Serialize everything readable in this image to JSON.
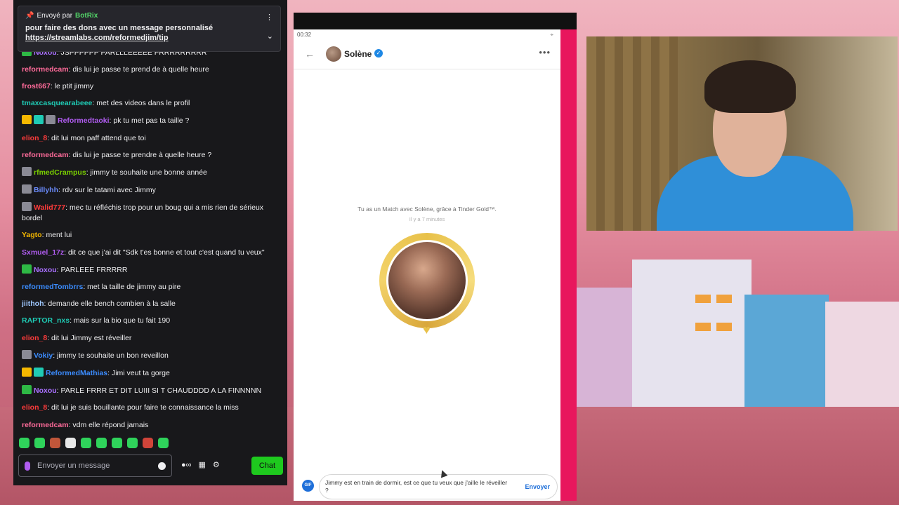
{
  "pinned": {
    "sent_by": "Envoyé par",
    "bot_name": "BotRix",
    "text": "pour faire des dons avec un message personnalisé",
    "link": "https://streamlabs.com/reformedjim/tip"
  },
  "messages": [
    {
      "user": "Noxou",
      "color": "#a970ff",
      "text": "JSPPPPPP PARLLLEEEEE FRRRRRRRRR",
      "badges": [
        "green"
      ]
    },
    {
      "user": "reformedcam",
      "color": "#ff6b9a",
      "text": "dis lui je passe te prend de à quelle heure",
      "badges": []
    },
    {
      "user": "frost667",
      "color": "#ff6b9a",
      "text": "le ptit jimmy",
      "badges": []
    },
    {
      "user": "tmaxcasquearabeee",
      "color": "#1fcbb5",
      "text": "met des videos dans le profil",
      "badges": []
    },
    {
      "user": "Reformedtaoki",
      "color": "#b05cf0",
      "text": "pk tu met pas ta taille ?",
      "badges": [
        "crown",
        "teal",
        "gray"
      ]
    },
    {
      "user": "elion_8",
      "color": "#ff3b3b",
      "text": "dit lui mon paff attend que toi",
      "badges": []
    },
    {
      "user": "reformedcam",
      "color": "#ff6b9a",
      "text": "dis lui je passe te prendre à quelle heure ?",
      "badges": []
    },
    {
      "user": "rfmedCrampus",
      "color": "#7ad000",
      "text": "jimmy te souhaite une bonne année",
      "badges": [
        "gray"
      ]
    },
    {
      "user": "Billyhh",
      "color": "#6b8cff",
      "text": "rdv sur le tatami avec Jimmy",
      "badges": [
        "gray"
      ]
    },
    {
      "user": "Walid777",
      "color": "#ff3b3b",
      "text": "mec tu réfléchis trop pour un boug qui a mis rien de sérieux bordel",
      "badges": [
        "gray"
      ]
    },
    {
      "user": "Yagto",
      "color": "#f5b800",
      "text": "ment lui",
      "badges": []
    },
    {
      "user": "Sxmuel_17z",
      "color": "#b05cf0",
      "text": "dit ce que j'ai dit \"Sdk t'es bonne et tout c'est quand tu veux\"",
      "badges": []
    },
    {
      "user": "Noxou",
      "color": "#a970ff",
      "text": "PARLEEE FRRRRR",
      "badges": [
        "green"
      ]
    },
    {
      "user": "reformedTombrrs",
      "color": "#3b8cff",
      "text": "met la taille de jimmy au pire",
      "badges": []
    },
    {
      "user": "jiithoh",
      "color": "#9fc8ff",
      "text": "demande elle bench combien à la salle",
      "badges": []
    },
    {
      "user": "RAPTOR_nxs",
      "color": "#1fcbb5",
      "text": "mais sur la bio que tu fait 190",
      "badges": []
    },
    {
      "user": "elion_8",
      "color": "#ff3b3b",
      "text": "dit lui Jimmy est réveiller",
      "badges": []
    },
    {
      "user": "Vokiy",
      "color": "#3b8cff",
      "text": "jimmy te souhaite un bon reveillon",
      "badges": [
        "gray"
      ]
    },
    {
      "user": "ReformedMathias",
      "color": "#3b8cff",
      "text": "Jimi veut ta gorge",
      "badges": [
        "crown",
        "teal"
      ]
    },
    {
      "user": "Noxou",
      "color": "#a970ff",
      "text": "PARLE FRRR ET DIT LUIII SI T CHAUDDDD A LA FINNNNN",
      "badges": [
        "green"
      ]
    },
    {
      "user": "elion_8",
      "color": "#ff3b3b",
      "text": "dit lui je suis bouillante pour faire te connaissance la miss",
      "badges": []
    },
    {
      "user": "reformedcam",
      "color": "#ff6b9a",
      "text": "vdm elle répond jamais",
      "badges": []
    }
  ],
  "chat_input": {
    "placeholder": "Envoyer un message"
  },
  "chat_button": "Chat",
  "phone": {
    "time": "00:32",
    "contact_name": "Solène",
    "match_text": "Tu as un Match avec Solène, grâce à Tinder Gold™.",
    "match_time": "Il y a 7 minutes",
    "compose_text": "Jimmy est en train de dormir, est ce que tu veux que j'aille le réveiller ?",
    "send_label": "Envoyer",
    "gif_label": "GIF"
  }
}
